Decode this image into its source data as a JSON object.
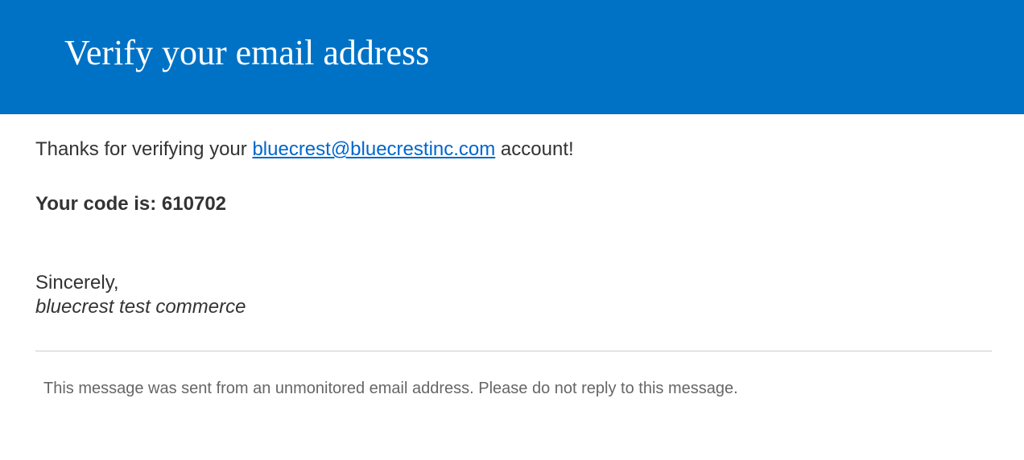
{
  "header": {
    "title": "Verify your email address"
  },
  "body": {
    "thanks_prefix": "Thanks for verifying your ",
    "email": "bluecrest@bluecrestinc.com",
    "thanks_suffix": " account!",
    "code_label": "Your code is: ",
    "code_value": "610702",
    "sincerely": "Sincerely,",
    "signature": "bluecrest test commerce"
  },
  "footer": {
    "note": "This message was sent from an unmonitored email address. Please do not reply to this message."
  }
}
